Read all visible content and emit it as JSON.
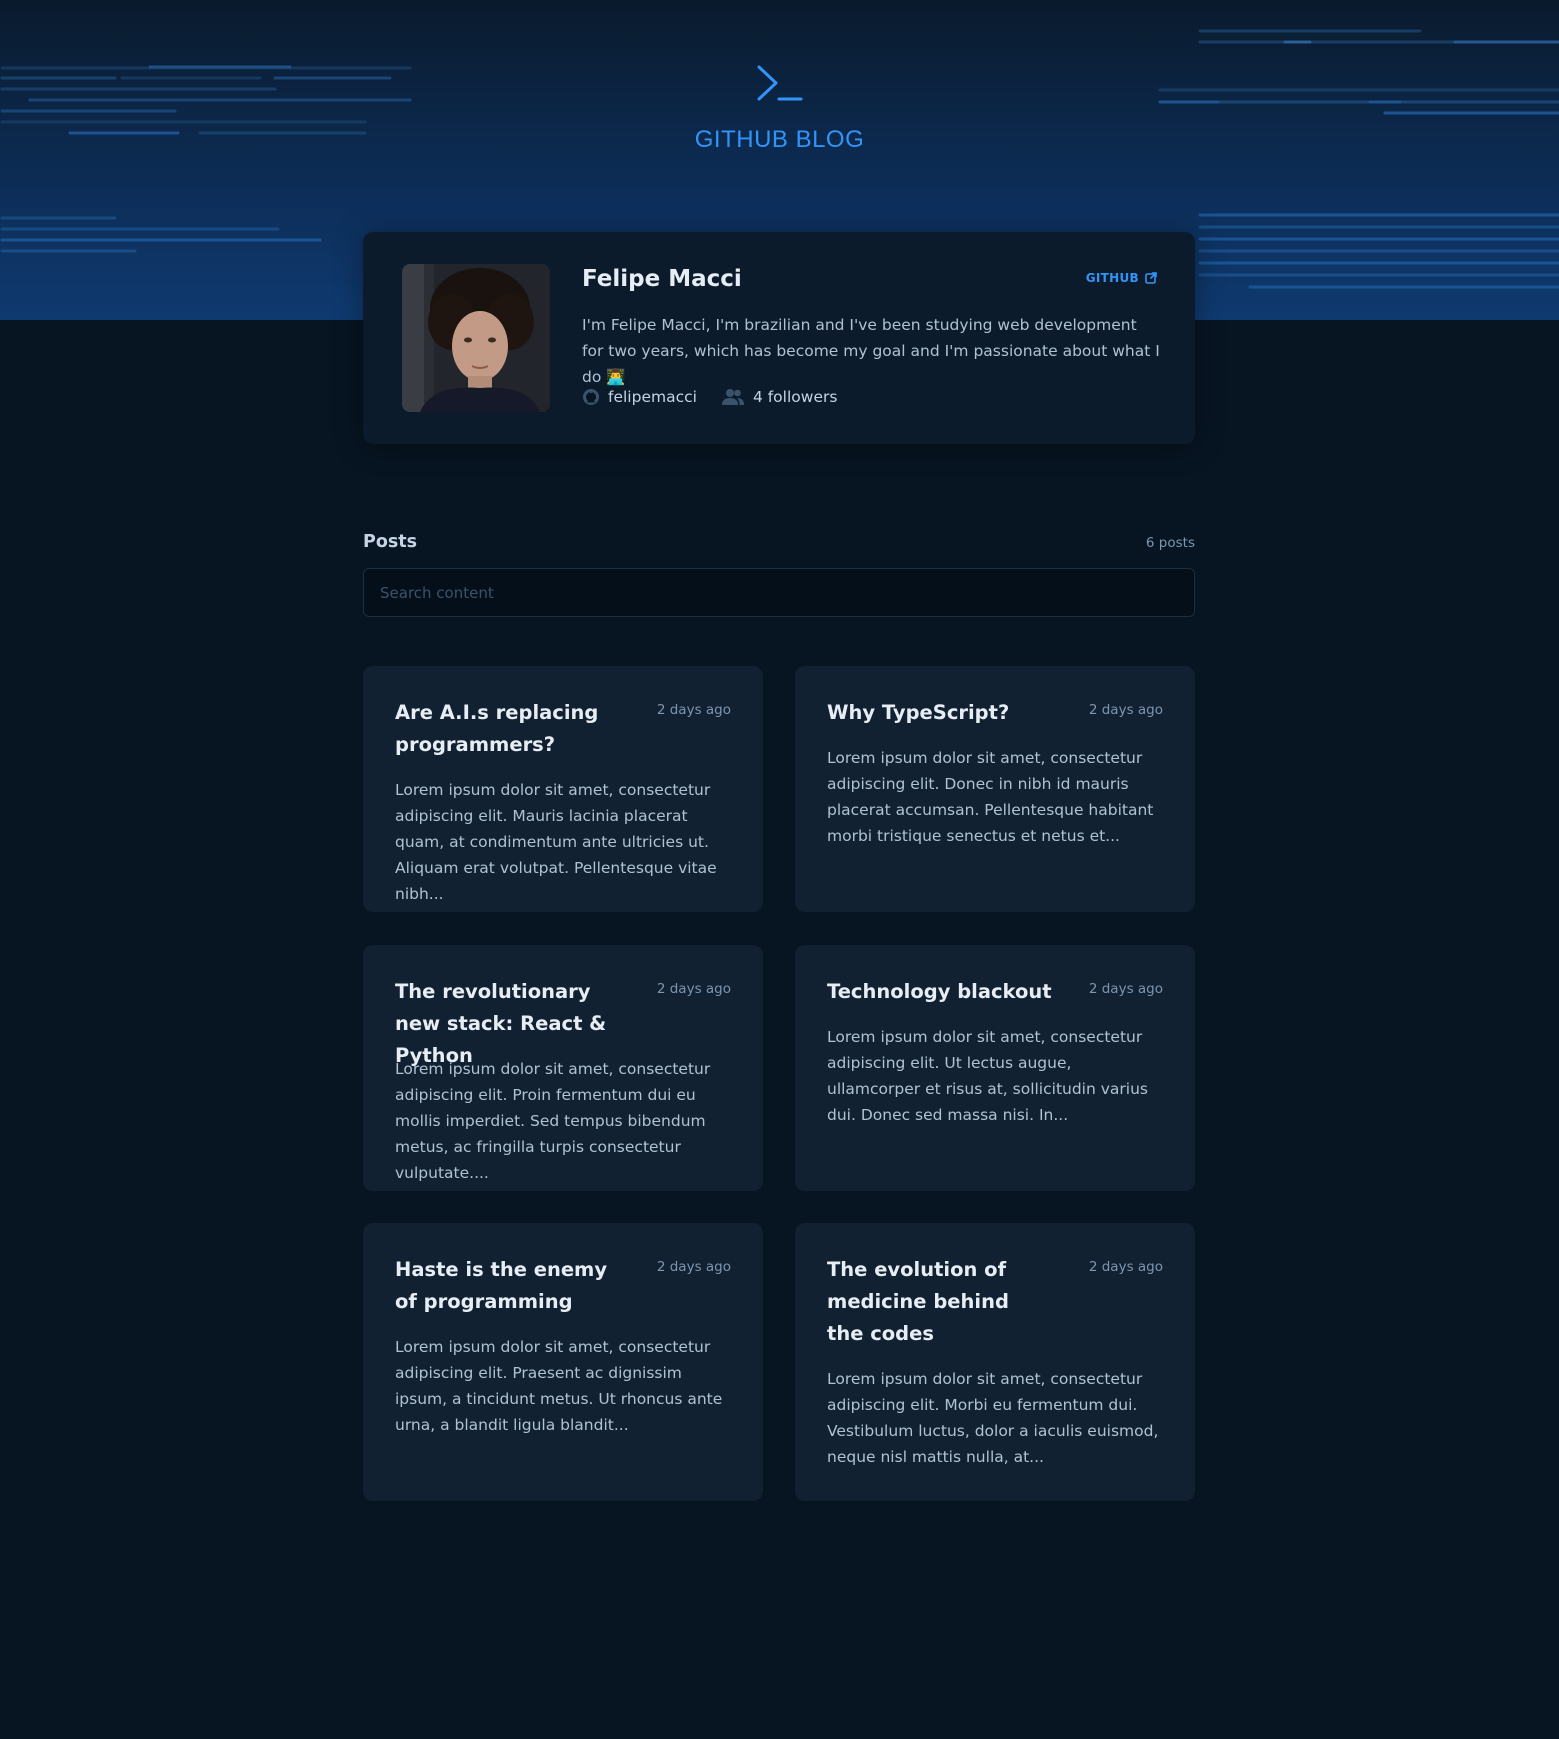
{
  "header": {
    "logo_icon": "terminal-prompt-icon",
    "title": "GITHUB BLOG",
    "accent_color": "#3294f8"
  },
  "profile": {
    "name": "Felipe Macci",
    "github_label": "GITHUB",
    "github_icon": "external-link-icon",
    "bio": "I'm Felipe Macci, I'm brazilian and I've been studying web development for two years, which has become my goal and I'm passionate about what I do 👨‍💻",
    "username": "felipemacci",
    "username_icon": "github-icon",
    "followers": "4 followers",
    "followers_icon": "users-icon"
  },
  "posts": {
    "title": "Posts",
    "count": "6 posts",
    "search_placeholder": "Search content",
    "items": [
      {
        "title": "Are A.I.s replacing programmers?",
        "date": "2 days ago",
        "excerpt": "Lorem ipsum dolor sit amet, consectetur adipiscing elit. Mauris lacinia placerat quam, at condimentum ante ultricies ut. Aliquam erat volutpat. Pellentesque vitae nibh..."
      },
      {
        "title": "Why TypeScript?",
        "date": "2 days ago",
        "excerpt": "Lorem ipsum dolor sit amet, consectetur adipiscing elit. Donec in nibh id mauris placerat accumsan. Pellentesque habitant morbi tristique senectus et netus et..."
      },
      {
        "title": "The revolutionary new stack: React & Python",
        "date": "2 days ago",
        "excerpt": "Lorem ipsum dolor sit amet, consectetur adipiscing elit. Proin fermentum dui eu mollis imperdiet. Sed tempus bibendum metus, ac fringilla turpis consectetur vulputate...."
      },
      {
        "title": "Technology blackout",
        "date": "2 days ago",
        "excerpt": "Lorem ipsum dolor sit amet, consectetur adipiscing elit. Ut lectus augue, ullamcorper et risus at, sollicitudin varius dui. Donec sed massa nisi. In..."
      },
      {
        "title": "Haste is the enemy of programming",
        "date": "2 days ago",
        "excerpt": "Lorem ipsum dolor sit amet, consectetur adipiscing elit. Praesent ac dignissim ipsum, a tincidunt metus. Ut rhoncus ante urna, a blandit ligula blandit..."
      },
      {
        "title": "The evolution of medicine behind the codes",
        "date": "2 days ago",
        "excerpt": "Lorem ipsum dolor sit amet, consectetur adipiscing elit. Morbi eu fermentum dui. Vestibulum luctus, dolor a iaculis euismod, neque nisl mattis nulla, at..."
      }
    ]
  }
}
